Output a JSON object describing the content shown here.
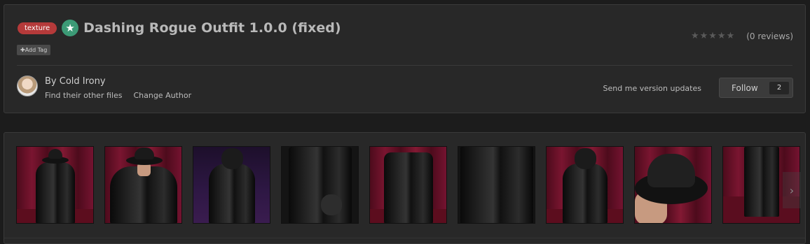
{
  "file": {
    "tag": "texture",
    "title": "Dashing Rogue Outfit 1.0.0 (fixed)",
    "add_tag_label": "Add Tag",
    "rating_stars": 0,
    "rating_max": 5,
    "reviews_label": "(0 reviews)"
  },
  "author": {
    "by_label": "By Cold Irony",
    "find_files_label": "Find their other files",
    "change_author_label": "Change Author"
  },
  "actions": {
    "version_updates_label": "Send me version updates",
    "follow_label": "Follow",
    "follow_count": "2"
  },
  "gallery": {
    "next_icon": "chevron-right-icon",
    "thumbnails": [
      "outfit-front-hat",
      "outfit-arms-crossed",
      "outfit-hood-purple",
      "outfit-sleeve-closeup",
      "outfit-coat-front",
      "outfit-zip-closeup",
      "outfit-hood-back",
      "hat-closeup",
      "outfit-legs-boots"
    ]
  },
  "colors": {
    "tag": "#b53a3a",
    "featured": "#3c9a76",
    "panel": "#282828",
    "page": "#1c1c1c"
  }
}
